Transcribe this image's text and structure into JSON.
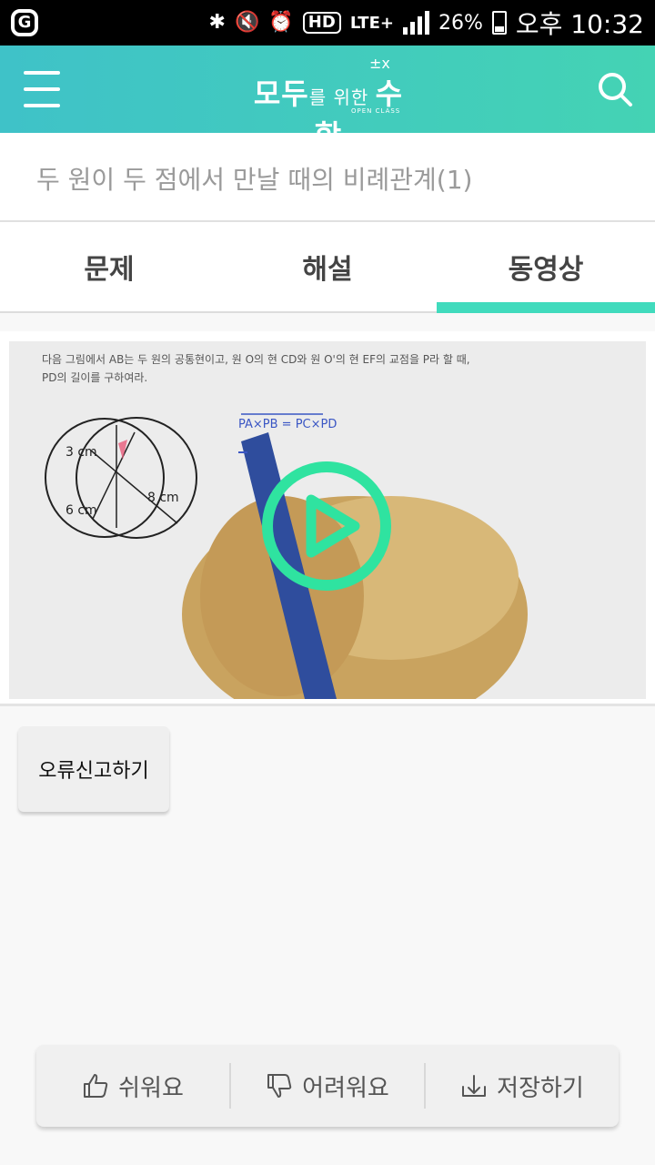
{
  "status_bar": {
    "battery_percent": "26%",
    "carrier_tag": "LTE+",
    "hd_badge": "HD",
    "time": "오후 10:32",
    "left_badge": "G"
  },
  "header": {
    "logo_main_1": "모두",
    "logo_main_small": "를 위한 ",
    "logo_main_2": "수학",
    "logo_sup": "±x",
    "logo_sub": "OPEN CLASS"
  },
  "title": "두 원이 두 점에서 만날 때의 비례관계(1)",
  "tabs": [
    {
      "label": "문제",
      "active": false
    },
    {
      "label": "해설",
      "active": false
    },
    {
      "label": "동영상",
      "active": true
    }
  ],
  "video": {
    "problem_text_line1": "다음 그림에서 AB는 두 원의 공통현이고, 원 O의 현 CD와 원 O'의 현 EF의 교점을 P라 할 때,",
    "problem_text_line2": "PD의 길이를 구하여라.",
    "handwriting": "PA×PB = PC×PD",
    "label_3cm": "3 cm",
    "label_6cm": "6 cm",
    "label_8cm": "8 cm"
  },
  "report_button": "오류신고하기",
  "actions": [
    {
      "label": "쉬워요",
      "icon": "thumbs-up-icon"
    },
    {
      "label": "어려워요",
      "icon": "thumbs-down-icon"
    },
    {
      "label": "저장하기",
      "icon": "download-tray-icon"
    }
  ],
  "colors": {
    "header_start": "#3fc2c8",
    "header_end": "#44d3b4",
    "accent": "#41dbbd",
    "play": "#2fe3a0"
  }
}
